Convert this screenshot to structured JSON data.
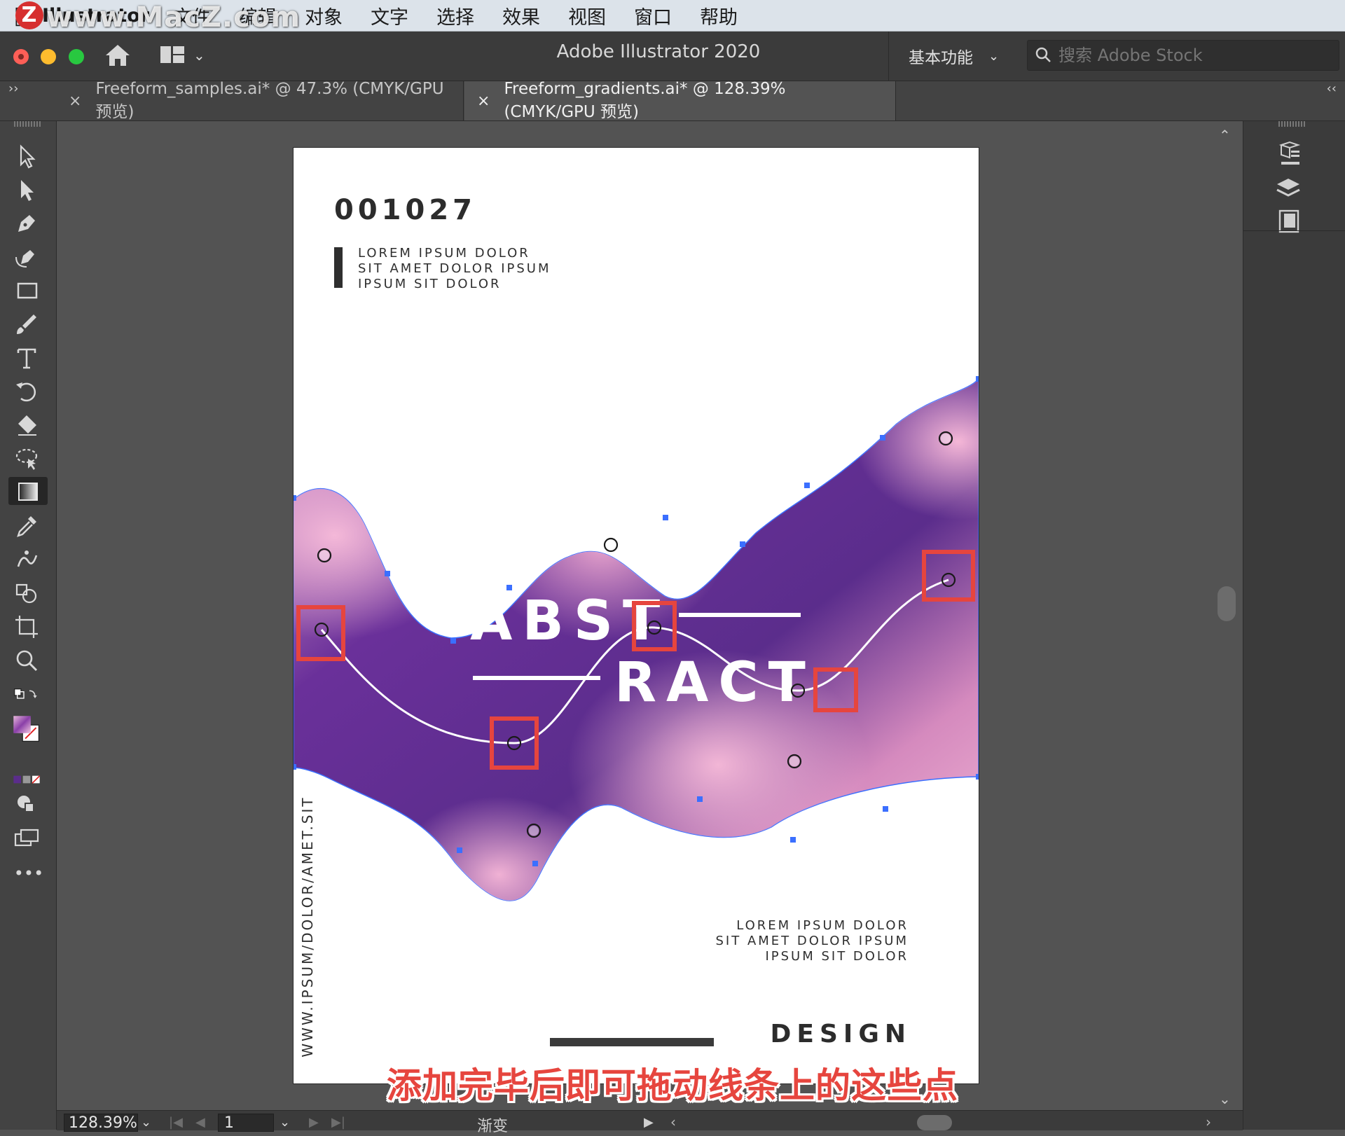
{
  "menubar": {
    "apple_icon": "apple-icon",
    "app_name": "Illustrator",
    "items": [
      "文件",
      "编辑",
      "对象",
      "文字",
      "选择",
      "效果",
      "视图",
      "窗口",
      "帮助"
    ]
  },
  "watermark": {
    "badge": "Z",
    "text": "www.MacZ.com"
  },
  "appbar": {
    "title": "Adobe Illustrator 2020",
    "workspace_label": "基本功能",
    "stock_search_placeholder": "搜索 Adobe Stock"
  },
  "tabs": [
    {
      "close": "×",
      "label": "Freeform_samples.ai* @ 47.3% (CMYK/GPU 预览)",
      "active": false
    },
    {
      "close": "×",
      "label": "Freeform_gradients.ai* @ 128.39% (CMYK/GPU 预览)",
      "active": true
    }
  ],
  "panel_toggles": {
    "left": "››",
    "right": "‹‹"
  },
  "tools": [
    "selection-tool-icon",
    "direct-selection-tool-icon",
    "pen-tool-icon",
    "curvature-tool-icon",
    "rectangle-tool-icon",
    "paintbrush-tool-icon",
    "type-tool-icon",
    "rotate-tool-icon",
    "eraser-tool-icon",
    "lasso-tool-icon",
    "gradient-tool-icon",
    "eyedropper-tool-icon",
    "puppet-warp-tool-icon",
    "shape-builder-tool-icon",
    "artboard-tool-icon",
    "zoom-tool-icon"
  ],
  "toolbar_more": "•••",
  "artboard": {
    "doc_number": "001027",
    "tagline_top": [
      "LOREM IPSUM DOLOR",
      "SIT AMET DOLOR IPSUM",
      "IPSUM SIT DOLOR"
    ],
    "headline_1": "ABST",
    "headline_2": "RACT",
    "vertical_url": "WWW.IPSUM/DOLOR/AMET.SIT",
    "tagline_bottom": [
      "LOREM IPSUM DOLOR",
      "SIT AMET DOLOR IPSUM",
      "IPSUM SIT DOLOR"
    ],
    "design_word": "DESIGN"
  },
  "caption": "添加完毕后即可拖动线条上的这些点",
  "colors": {
    "gradient_dark": "#5b2d8c",
    "gradient_mid": "#7b3ea3",
    "gradient_light": "#f0a9cf",
    "anchor_blue": "#3b6fff",
    "highlight_red": "#e6453e"
  },
  "statusbar": {
    "zoom": "128.39%",
    "page": "1",
    "status_label": "渐变"
  }
}
